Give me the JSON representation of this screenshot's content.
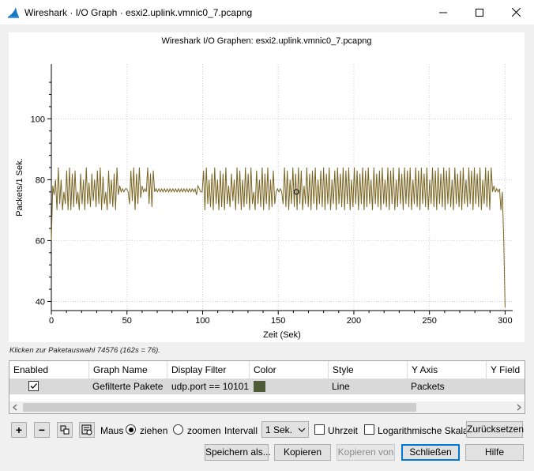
{
  "window": {
    "title": "Wireshark · I/O Graph · esxi2.uplink.vmnic0_7.pcapng",
    "minimize_icon": "minimize-icon",
    "maximize_icon": "maximize-icon",
    "close_icon": "close-icon"
  },
  "chart_data": {
    "type": "line",
    "title": "Wireshark I/O Graphen: esxi2.uplink.vmnic0_7.pcapng",
    "xlabel": "Zeit (Sek)",
    "ylabel": "Packets/1 Sek.",
    "xlim": [
      0,
      305
    ],
    "ylim": [
      37,
      118
    ],
    "x_ticks": [
      0,
      50,
      100,
      150,
      200,
      250,
      300
    ],
    "y_ticks": [
      40,
      60,
      80,
      100
    ],
    "grid": true,
    "color": "#7a6420",
    "marker": {
      "x": 162,
      "y": 76
    },
    "series": [
      {
        "values": [
          60,
          78,
          75,
          80,
          70,
          84,
          72,
          80,
          70,
          76,
          72,
          83,
          70,
          84,
          70,
          82,
          71,
          83,
          72,
          76,
          70,
          82,
          72,
          80,
          70,
          84,
          72,
          79,
          71,
          82,
          73,
          80,
          71,
          83,
          72,
          84,
          70,
          81,
          72,
          76,
          70,
          83,
          72,
          80,
          71,
          82,
          70,
          84,
          75,
          78,
          76,
          77,
          76,
          77,
          77,
          76,
          72,
          83,
          73,
          84,
          70,
          82,
          72,
          84,
          74,
          78,
          76,
          77,
          76,
          84,
          72,
          82,
          71,
          83,
          76,
          77,
          76,
          77,
          76,
          77,
          76,
          77,
          76,
          77,
          76,
          77,
          76,
          77,
          76,
          77,
          76,
          77,
          76,
          77,
          76,
          77,
          76,
          77,
          76,
          77,
          76,
          77,
          76,
          77,
          75,
          78,
          77,
          76,
          76,
          83,
          70,
          84,
          72,
          80,
          71,
          82,
          70,
          84,
          72,
          80,
          70,
          83,
          71,
          82,
          70,
          84,
          72,
          78,
          71,
          82,
          73,
          80,
          70,
          84,
          72,
          83,
          70,
          80,
          71,
          84,
          72,
          82,
          70,
          84,
          72,
          76,
          70,
          83,
          72,
          80,
          71,
          84,
          70,
          82,
          72,
          84,
          70,
          80,
          71,
          83,
          72,
          76,
          77,
          76,
          77,
          76,
          72,
          84,
          71,
          83,
          70,
          80,
          72,
          84,
          71,
          82,
          70,
          84,
          72,
          83,
          70,
          78,
          72,
          84,
          71,
          82,
          70,
          83,
          72,
          84,
          70,
          80,
          72,
          83,
          71,
          84,
          70,
          82,
          72,
          84,
          70,
          80,
          72,
          83,
          70,
          84,
          72,
          82,
          71,
          84,
          70,
          83,
          72,
          84,
          70,
          80,
          71,
          84,
          72,
          83,
          70,
          82,
          72,
          84,
          70,
          83,
          71,
          84,
          72,
          80,
          70,
          84,
          72,
          82,
          71,
          83,
          70,
          84,
          72,
          80,
          71,
          84,
          70,
          83,
          72,
          84,
          70,
          80,
          71,
          84,
          72,
          82,
          70,
          84,
          72,
          83,
          71,
          84,
          70,
          80,
          72,
          84,
          71,
          83,
          70,
          84,
          72,
          82,
          71,
          84,
          70,
          80,
          72,
          84,
          71,
          83,
          70,
          84,
          72,
          82,
          71,
          84,
          70,
          83,
          72,
          84,
          71,
          80,
          70,
          84,
          72,
          82,
          71,
          83,
          70,
          84,
          72,
          80,
          71,
          84,
          72,
          83,
          70,
          84,
          72,
          82,
          71,
          84,
          70,
          80,
          72,
          84,
          71,
          83,
          70,
          84,
          76,
          78,
          76,
          77,
          76,
          77,
          70,
          76,
          60,
          38
        ]
      }
    ]
  },
  "status": "Klicken zur Paketauswahl 74576 (162s = 76).",
  "table": {
    "headers": [
      "Enabled",
      "Graph Name",
      "Display Filter",
      "Color",
      "Style",
      "Y Axis",
      "Y Field"
    ],
    "row": {
      "enabled": true,
      "name": "Gefilterte Pakete",
      "filter": "udp.port == 10101",
      "color": "#4f5a36",
      "style": "Line",
      "y_axis": "Packets"
    }
  },
  "toolbar": {
    "add_label": "+",
    "remove_label": "−",
    "mouse_label": "Maus",
    "drag_label": "ziehen",
    "zoom_label": "zoomen",
    "interval_label": "Intervall",
    "interval_value": "1 Sek.",
    "time_label": "Uhrzeit",
    "log_label": "Logarithmische Skala",
    "reset_label": "Zurücksetzen"
  },
  "buttons": {
    "save": "Speichern als...",
    "copy": "Kopieren",
    "copy_from": "Kopieren von",
    "close": "Schließen",
    "help": "Hilfe"
  }
}
